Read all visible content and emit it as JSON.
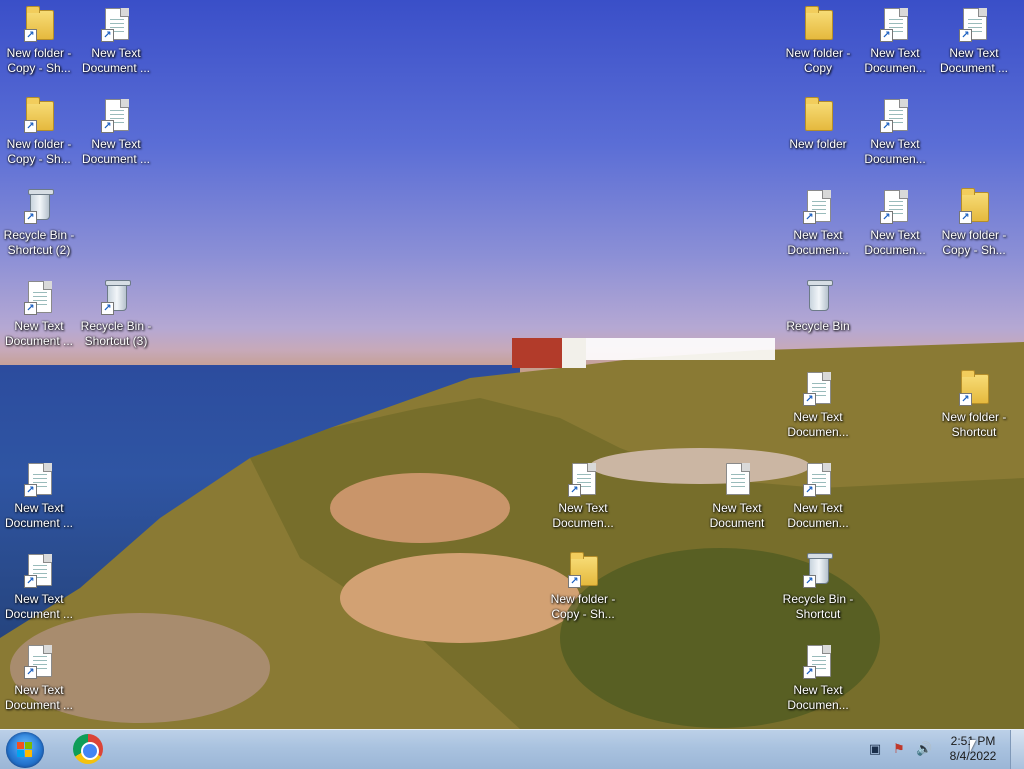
{
  "desktop": {
    "icons": [
      {
        "label": "New folder -\nCopy - Sh...",
        "type": "folder",
        "shortcut": true,
        "col": 0,
        "row": 0
      },
      {
        "label": "New Text\nDocument ...",
        "type": "doc",
        "shortcut": true,
        "col": 1,
        "row": 0
      },
      {
        "label": "New folder -\nCopy - Sh...",
        "type": "folder",
        "shortcut": true,
        "col": 0,
        "row": 1
      },
      {
        "label": "New Text\nDocument ...",
        "type": "doc",
        "shortcut": true,
        "col": 1,
        "row": 1
      },
      {
        "label": "Recycle Bin -\nShortcut (2)",
        "type": "bin",
        "shortcut": true,
        "col": 0,
        "row": 2
      },
      {
        "label": "New Text\nDocument ...",
        "type": "doc",
        "shortcut": true,
        "col": 0,
        "row": 3
      },
      {
        "label": "Recycle Bin -\nShortcut (3)",
        "type": "bin",
        "shortcut": true,
        "col": 1,
        "row": 3
      },
      {
        "label": "New Text\nDocument ...",
        "type": "doc",
        "shortcut": true,
        "col": 0,
        "row": 5
      },
      {
        "label": "New Text\nDocument ...",
        "type": "doc",
        "shortcut": true,
        "col": 0,
        "row": 6
      },
      {
        "label": "New Text\nDocument ...",
        "type": "doc",
        "shortcut": true,
        "col": 0,
        "row": 7
      },
      {
        "label": "New Text\nDocumen...",
        "type": "doc",
        "shortcut": true,
        "col": 7,
        "row": 5
      },
      {
        "label": "New folder -\nCopy - Sh...",
        "type": "folder",
        "shortcut": true,
        "col": 7,
        "row": 6
      },
      {
        "label": "New Text\nDocument",
        "type": "doc",
        "shortcut": false,
        "col": 9,
        "row": 5
      },
      {
        "label": "New Text\nDocumen...",
        "type": "doc",
        "shortcut": true,
        "col": 10,
        "row": 5
      },
      {
        "label": "Recycle Bin -\nShortcut",
        "type": "bin",
        "shortcut": true,
        "col": 10,
        "row": 6
      },
      {
        "label": "New Text\nDocumen...",
        "type": "doc",
        "shortcut": true,
        "col": 10,
        "row": 7
      },
      {
        "label": "New folder -\nCopy",
        "type": "folder",
        "shortcut": false,
        "col": 10,
        "row": 0
      },
      {
        "label": "New Text\nDocumen...",
        "type": "doc",
        "shortcut": true,
        "col": 11,
        "row": 0
      },
      {
        "label": "New Text\nDocument ...",
        "type": "doc",
        "shortcut": true,
        "col": 12,
        "row": 0
      },
      {
        "label": "New folder",
        "type": "folder",
        "shortcut": false,
        "col": 10,
        "row": 1
      },
      {
        "label": "New Text\nDocumen...",
        "type": "doc",
        "shortcut": true,
        "col": 11,
        "row": 1
      },
      {
        "label": "New Text\nDocumen...",
        "type": "doc",
        "shortcut": true,
        "col": 10,
        "row": 2
      },
      {
        "label": "New Text\nDocumen...",
        "type": "doc",
        "shortcut": true,
        "col": 11,
        "row": 2
      },
      {
        "label": "New folder -\nCopy - Sh...",
        "type": "folder",
        "shortcut": true,
        "col": 12,
        "row": 2
      },
      {
        "label": "Recycle Bin",
        "type": "bin",
        "shortcut": false,
        "col": 10,
        "row": 3
      },
      {
        "label": "New Text\nDocumen...",
        "type": "doc",
        "shortcut": true,
        "col": 10,
        "row": 4
      },
      {
        "label": "New folder -\nShortcut",
        "type": "folder",
        "shortcut": true,
        "col": 12,
        "row": 4
      }
    ]
  },
  "taskbar": {
    "start_label": "Start",
    "pinned": [
      {
        "name": "Google Chrome"
      }
    ],
    "clock": {
      "time": "2:51 PM",
      "date": "8/4/2022"
    }
  }
}
